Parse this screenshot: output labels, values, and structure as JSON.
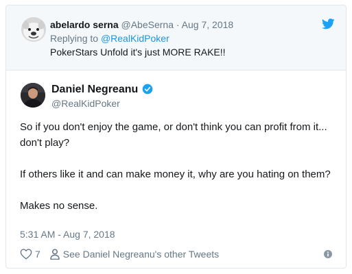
{
  "reply_tweet": {
    "display_name": "abelardo serna",
    "handle": "@AbeSerna",
    "separator": "·",
    "date": "Aug 7, 2018",
    "replying_prefix": "Replying to",
    "replying_to": "@RealKidPoker",
    "text": "PokerStars Unfold it's just MORE RAKE!!",
    "avatar_icon": "bulldog-avatar"
  },
  "main_tweet": {
    "display_name": "Daniel Negreanu",
    "handle": "@RealKidPoker",
    "verified_icon": "verified-badge-icon",
    "paragraphs": [
      "So if you don't enjoy the game, or don't think you can profit from it... don't play?",
      "If others like it and can make money it, why are you hating on them?",
      "Makes no sense."
    ],
    "timestamp": "5:31 AM - Aug 7, 2018",
    "likes": "7",
    "see_other_tweets": "See Daniel Negreanu's other Tweets"
  },
  "colors": {
    "twitter_blue": "#1da1f2",
    "link_blue": "#1b95e0",
    "muted_text": "#657786",
    "reply_background": "#f5f8fa",
    "border": "#e1e8ed"
  },
  "icons": {
    "brand": "twitter-bird-icon",
    "like": "heart-icon",
    "profile": "person-icon",
    "info": "info-icon"
  }
}
